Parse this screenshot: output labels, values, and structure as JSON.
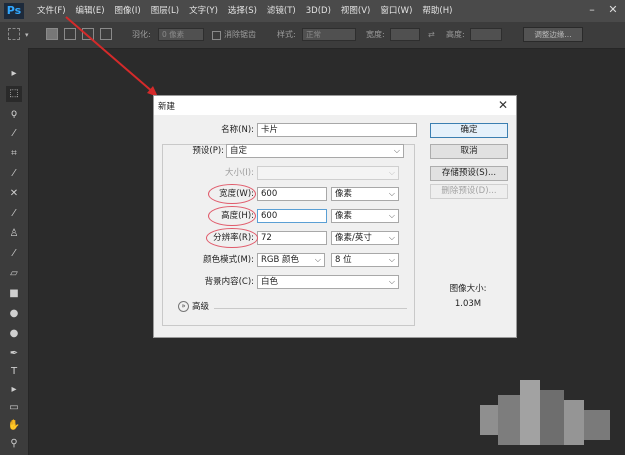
{
  "app": {
    "logo": "Ps",
    "menu": [
      "文件(F)",
      "编辑(E)",
      "图像(I)",
      "图层(L)",
      "文字(Y)",
      "选择(S)",
      "滤镜(T)",
      "3D(D)",
      "视图(V)",
      "窗口(W)",
      "帮助(H)"
    ],
    "window_controls": {
      "minimize": "–",
      "close": "✕"
    }
  },
  "options_bar": {
    "feather_label": "羽化:",
    "feather_value": "0 像素",
    "antialias_label": "消除锯齿",
    "style_label": "样式:",
    "style_value": "正常",
    "width_label": "宽度:",
    "height_label": "高度:",
    "refine_edge": "调整边缘..."
  },
  "toolbar": {
    "icons": [
      "move-tool-icon",
      "marquee-tool-icon",
      "lasso-tool-icon",
      "quick-select-tool-icon",
      "crop-tool-icon",
      "eyedropper-tool-icon",
      "healing-brush-tool-icon",
      "brush-tool-icon",
      "clone-stamp-tool-icon",
      "history-brush-tool-icon",
      "eraser-tool-icon",
      "gradient-tool-icon",
      "blur-tool-icon",
      "dodge-tool-icon",
      "pen-tool-icon",
      "type-tool-icon",
      "path-select-tool-icon",
      "shape-tool-icon",
      "hand-tool-icon",
      "zoom-tool-icon"
    ]
  },
  "dialog": {
    "title": "新建",
    "name_label": "名称(N):",
    "name_value": "卡片",
    "preset_label": "预设(P):",
    "preset_value": "自定",
    "size_label": "大小(I):",
    "size_value": "",
    "width_label": "宽度(W):",
    "width_value": "600",
    "width_unit": "像素",
    "height_label": "高度(H):",
    "height_value": "600",
    "height_unit": "像素",
    "resolution_label": "分辨率(R):",
    "resolution_value": "72",
    "resolution_unit": "像素/英寸",
    "color_mode_label": "颜色模式(M):",
    "color_mode_value": "RGB 颜色",
    "bit_depth_value": "8 位",
    "background_label": "背景内容(C):",
    "background_value": "白色",
    "advanced_label": "高级",
    "ok_button": "确定",
    "cancel_button": "取消",
    "save_preset_button": "存储预设(S)...",
    "delete_preset_button": "删除预设(D)...",
    "image_size_label": "图像大小:",
    "image_size_value": "1.03M"
  },
  "colors": {
    "annotation_red": "#e05a6a",
    "arrow_red": "#d42a2a",
    "workspace_bg": "#2b2b2b"
  }
}
